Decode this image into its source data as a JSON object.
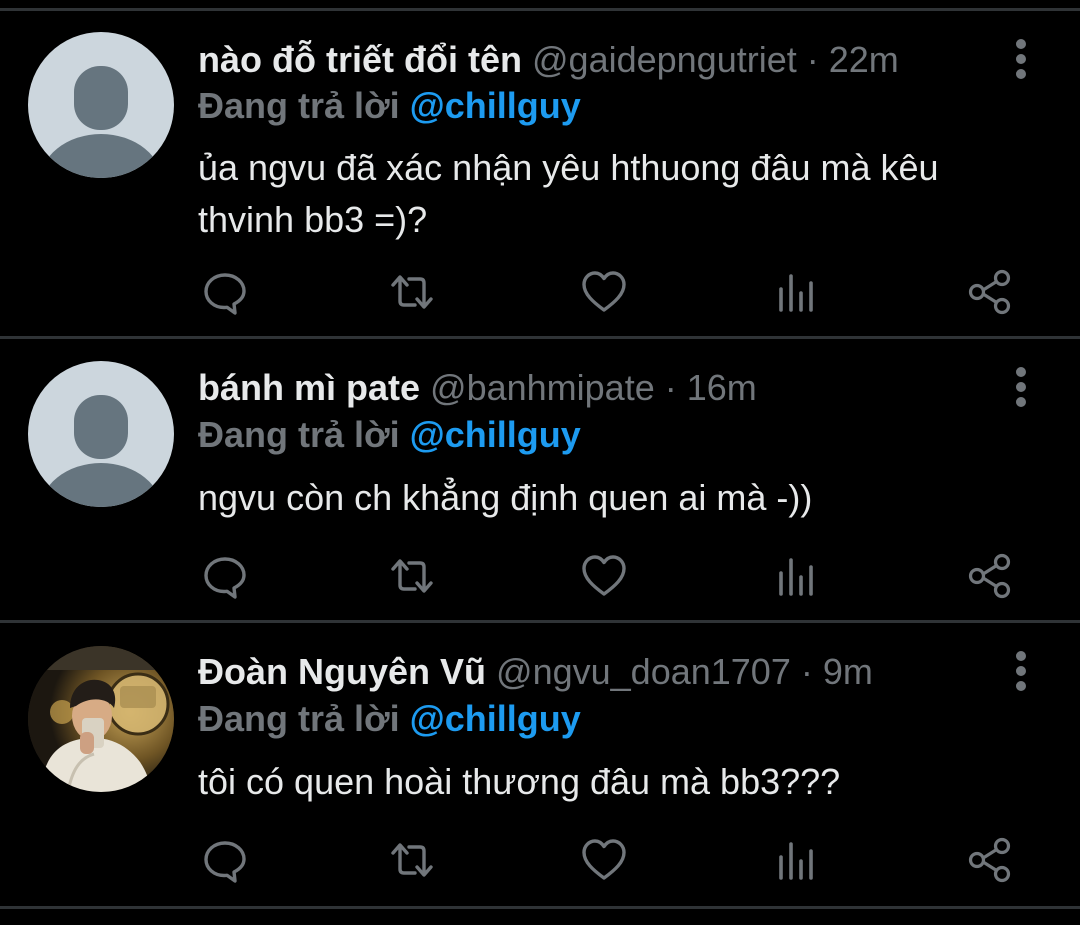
{
  "colors": {
    "background": "#000000",
    "divider": "#2f3336",
    "primary_text": "#e7e9ea",
    "secondary_text": "#71767b",
    "mention": "#1d9bf0",
    "default_avatar_bg": "#ccd6dd",
    "default_avatar_fg": "#66757f"
  },
  "icons": {
    "more": "vertical-dots-icon",
    "reply": "speech-bubble-icon",
    "retweet": "retweet-arrows-icon",
    "like": "heart-icon",
    "views": "bar-chart-icon",
    "share": "share-nodes-icon"
  },
  "tweets": [
    {
      "display_name": "nào đỗ triết đổi tên",
      "handle": "@gaidepngutriet",
      "separator": "·",
      "time": "22m",
      "reply_prefix": "Đang trả lời",
      "reply_mention": "@chillguy",
      "text_line1": "ủa ngvu đã xác nhận yêu hthuong đâu mà kêu",
      "text_line2": "thvinh bb3 =)?",
      "avatar": "default"
    },
    {
      "display_name": "bánh mì pate",
      "handle": "@banhmipate",
      "separator": "·",
      "time": "16m",
      "reply_prefix": "Đang trả lời",
      "reply_mention": "@chillguy",
      "text_line1": "ngvu còn ch khẳng định quen ai mà -))",
      "avatar": "default"
    },
    {
      "display_name": "Đoàn Nguyên Vũ",
      "handle": "@ngvu_doan1707",
      "separator": "·",
      "time": "9m",
      "reply_prefix": "Đang trả lời",
      "reply_mention": "@chillguy",
      "text_line1": "tôi có quen hoài thương đâu mà bb3???",
      "avatar": "photo"
    }
  ]
}
